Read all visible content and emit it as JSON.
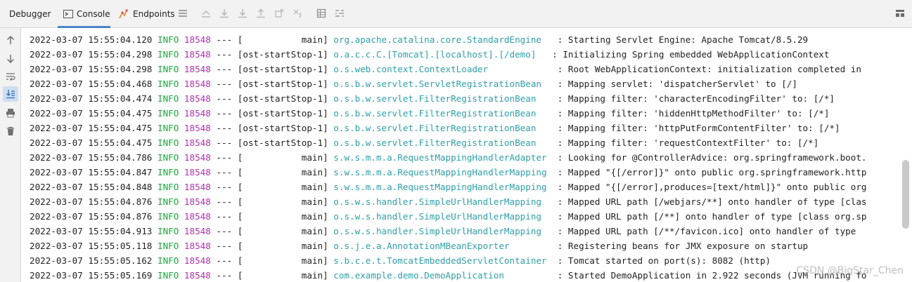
{
  "tabs": [
    {
      "label": "Debugger",
      "icon": "none"
    },
    {
      "label": "Console",
      "icon": "console-icon"
    },
    {
      "label": "Endpoints",
      "icon": "endpoints-icon"
    }
  ],
  "colors": {
    "info": "#19a83a",
    "pid": "#b02fb0",
    "logger": "#2e9fa8",
    "text": "#222222",
    "accent": "#4a86c8"
  },
  "toolbar_icons": [
    "menu-icon",
    "show-execution-point-icon",
    "step-over-icon",
    "step-into-icon",
    "step-out-icon",
    "run-to-cursor-icon",
    "evaluate-expression-icon",
    "table-icon",
    "settings-list-icon",
    "layout-icon"
  ],
  "sidebar_icons": [
    "up-arrow-icon",
    "down-arrow-icon",
    "soft-wrap-icon",
    "scroll-to-end-icon",
    "print-icon",
    "trash-icon"
  ],
  "log_lines": [
    {
      "ts": "2022-03-07 15:55:04.120",
      "level": "INFO",
      "pid": "18548",
      "sep": "---",
      "thread": "[           main]",
      "logger": "org.apache.catalina.core.StandardEngine  ",
      "msg": ": Starting Servlet Engine: Apache Tomcat/8.5.29"
    },
    {
      "ts": "2022-03-07 15:55:04.298",
      "level": "INFO",
      "pid": "18548",
      "sep": "---",
      "thread": "[ost-startStop-1]",
      "logger": "o.a.c.c.C.[Tomcat].[localhost].[/demo]  ",
      "msg": ": Initializing Spring embedded WebApplicationContext"
    },
    {
      "ts": "2022-03-07 15:55:04.298",
      "level": "INFO",
      "pid": "18548",
      "sep": "---",
      "thread": "[ost-startStop-1]",
      "logger": "o.s.web.context.ContextLoader            ",
      "msg": ": Root WebApplicationContext: initialization completed in"
    },
    {
      "ts": "2022-03-07 15:55:04.468",
      "level": "INFO",
      "pid": "18548",
      "sep": "---",
      "thread": "[ost-startStop-1]",
      "logger": "o.s.b.w.servlet.ServletRegistrationBean  ",
      "msg": ": Mapping servlet: 'dispatcherServlet' to [/]"
    },
    {
      "ts": "2022-03-07 15:55:04.474",
      "level": "INFO",
      "pid": "18548",
      "sep": "---",
      "thread": "[ost-startStop-1]",
      "logger": "o.s.b.w.servlet.FilterRegistrationBean   ",
      "msg": ": Mapping filter: 'characterEncodingFilter' to: [/*]"
    },
    {
      "ts": "2022-03-07 15:55:04.475",
      "level": "INFO",
      "pid": "18548",
      "sep": "---",
      "thread": "[ost-startStop-1]",
      "logger": "o.s.b.w.servlet.FilterRegistrationBean   ",
      "msg": ": Mapping filter: 'hiddenHttpMethodFilter' to: [/*]"
    },
    {
      "ts": "2022-03-07 15:55:04.475",
      "level": "INFO",
      "pid": "18548",
      "sep": "---",
      "thread": "[ost-startStop-1]",
      "logger": "o.s.b.w.servlet.FilterRegistrationBean   ",
      "msg": ": Mapping filter: 'httpPutFormContentFilter' to: [/*]"
    },
    {
      "ts": "2022-03-07 15:55:04.475",
      "level": "INFO",
      "pid": "18548",
      "sep": "---",
      "thread": "[ost-startStop-1]",
      "logger": "o.s.b.w.servlet.FilterRegistrationBean   ",
      "msg": ": Mapping filter: 'requestContextFilter' to: [/*]"
    },
    {
      "ts": "2022-03-07 15:55:04.786",
      "level": "INFO",
      "pid": "18548",
      "sep": "---",
      "thread": "[           main]",
      "logger": "s.w.s.m.m.a.RequestMappingHandlerAdapter ",
      "msg": ": Looking for @ControllerAdvice: org.springframework.boot."
    },
    {
      "ts": "2022-03-07 15:55:04.847",
      "level": "INFO",
      "pid": "18548",
      "sep": "---",
      "thread": "[           main]",
      "logger": "s.w.s.m.m.a.RequestMappingHandlerMapping ",
      "msg": ": Mapped \"{[/error]}\" onto public org.springframework.http"
    },
    {
      "ts": "2022-03-07 15:55:04.848",
      "level": "INFO",
      "pid": "18548",
      "sep": "---",
      "thread": "[           main]",
      "logger": "s.w.s.m.m.a.RequestMappingHandlerMapping ",
      "msg": ": Mapped \"{[/error],produces=[text/html]}\" onto public org"
    },
    {
      "ts": "2022-03-07 15:55:04.876",
      "level": "INFO",
      "pid": "18548",
      "sep": "---",
      "thread": "[           main]",
      "logger": "o.s.w.s.handler.SimpleUrlHandlerMapping  ",
      "msg": ": Mapped URL path [/webjars/**] onto handler of type [clas"
    },
    {
      "ts": "2022-03-07 15:55:04.876",
      "level": "INFO",
      "pid": "18548",
      "sep": "---",
      "thread": "[           main]",
      "logger": "o.s.w.s.handler.SimpleUrlHandlerMapping  ",
      "msg": ": Mapped URL path [/**] onto handler of type [class org.sp"
    },
    {
      "ts": "2022-03-07 15:55:04.913",
      "level": "INFO",
      "pid": "18548",
      "sep": "---",
      "thread": "[           main]",
      "logger": "o.s.w.s.handler.SimpleUrlHandlerMapping  ",
      "msg": ": Mapped URL path [/**/favicon.ico] onto handler of type "
    },
    {
      "ts": "2022-03-07 15:55:05.118",
      "level": "INFO",
      "pid": "18548",
      "sep": "---",
      "thread": "[           main]",
      "logger": "o.s.j.e.a.AnnotationMBeanExporter        ",
      "msg": ": Registering beans for JMX exposure on startup"
    },
    {
      "ts": "2022-03-07 15:55:05.162",
      "level": "INFO",
      "pid": "18548",
      "sep": "---",
      "thread": "[           main]",
      "logger": "s.b.c.e.t.TomcatEmbeddedServletContainer ",
      "msg": ": Tomcat started on port(s): 8082 (http)"
    },
    {
      "ts": "2022-03-07 15:55:05.169",
      "level": "INFO",
      "pid": "18548",
      "sep": "---",
      "thread": "[           main]",
      "logger": "com.example.demo.DemoApplication         ",
      "msg": ": Started DemoApplication in 2.922 seconds (JVM running fo"
    }
  ],
  "watermark": "CSDN @BigStar_Chen"
}
